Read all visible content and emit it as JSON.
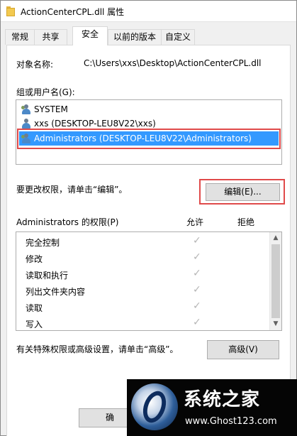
{
  "window": {
    "title": "ActionCenterCPL.dll 属性"
  },
  "tabs": [
    {
      "label": "常规"
    },
    {
      "label": "共享"
    },
    {
      "label": "安全"
    },
    {
      "label": "以前的版本"
    },
    {
      "label": "自定义"
    }
  ],
  "active_tab": "安全",
  "object": {
    "label": "对象名称:",
    "value": "C:\\Users\\xxs\\Desktop\\ActionCenterCPL.dll"
  },
  "groups": {
    "label": "组或用户名(G):",
    "items": [
      {
        "name": "SYSTEM",
        "icon": "group-users-icon"
      },
      {
        "name": "xxs (DESKTOP-LEU8V22\\xxs)",
        "icon": "user-icon"
      },
      {
        "name": "Administrators (DESKTOP-LEU8V22\\Administrators)",
        "icon": "group-users-icon",
        "selected": true
      }
    ]
  },
  "change_hint": "要更改权限，请单击“编辑”。",
  "edit_button": "编辑(E)...",
  "permissions": {
    "label": "Administrators 的权限(P)",
    "allow_header": "允许",
    "deny_header": "拒绝",
    "items": [
      {
        "name": "完全控制",
        "allow": true,
        "deny": false
      },
      {
        "name": "修改",
        "allow": true,
        "deny": false
      },
      {
        "name": "读取和执行",
        "allow": true,
        "deny": false
      },
      {
        "name": "列出文件夹内容",
        "allow": true,
        "deny": false
      },
      {
        "name": "读取",
        "allow": true,
        "deny": false
      },
      {
        "name": "写入",
        "allow": true,
        "deny": false
      }
    ]
  },
  "advanced_hint": "有关特殊权限或高级设置，请单击“高级”。",
  "advanced_button": "高级(V)",
  "ok_button_partial": "确",
  "watermark": {
    "title": "系统之家",
    "url": "www.Ghost123.com"
  },
  "colors": {
    "selection": "#3399ff",
    "highlight_frame": "#e04a4a"
  }
}
